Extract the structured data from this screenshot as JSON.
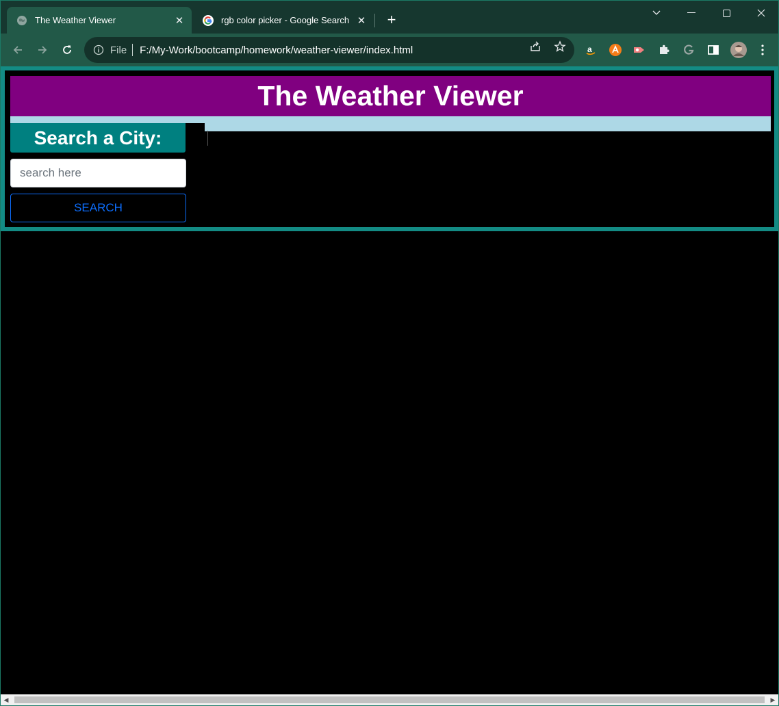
{
  "browser": {
    "tabs": [
      {
        "title": "The Weather Viewer",
        "active": true
      },
      {
        "title": "rgb color picker - Google Search",
        "active": false
      }
    ],
    "close_glyph": "✕",
    "new_tab_glyph": "+",
    "address": {
      "scheme_label": "File",
      "url": "F:/My-Work/bootcamp/homework/weather-viewer/index.html"
    },
    "extensions": [
      "amazon-icon",
      "avast-icon",
      "record-icon",
      "puzzle-icon",
      "grammarly-icon",
      "side-panel-icon",
      "profile-avatar",
      "menu-icon"
    ]
  },
  "page": {
    "header_title": "The Weather Viewer",
    "search_heading": "Search a City:",
    "search_placeholder": "search here",
    "search_button_label": "SEARCH"
  },
  "colors": {
    "header_bg": "#800080",
    "strip_bg": "#add8e6",
    "heading_bg": "#008080",
    "frame": "#138b84",
    "button_accent": "#0d6efd"
  }
}
